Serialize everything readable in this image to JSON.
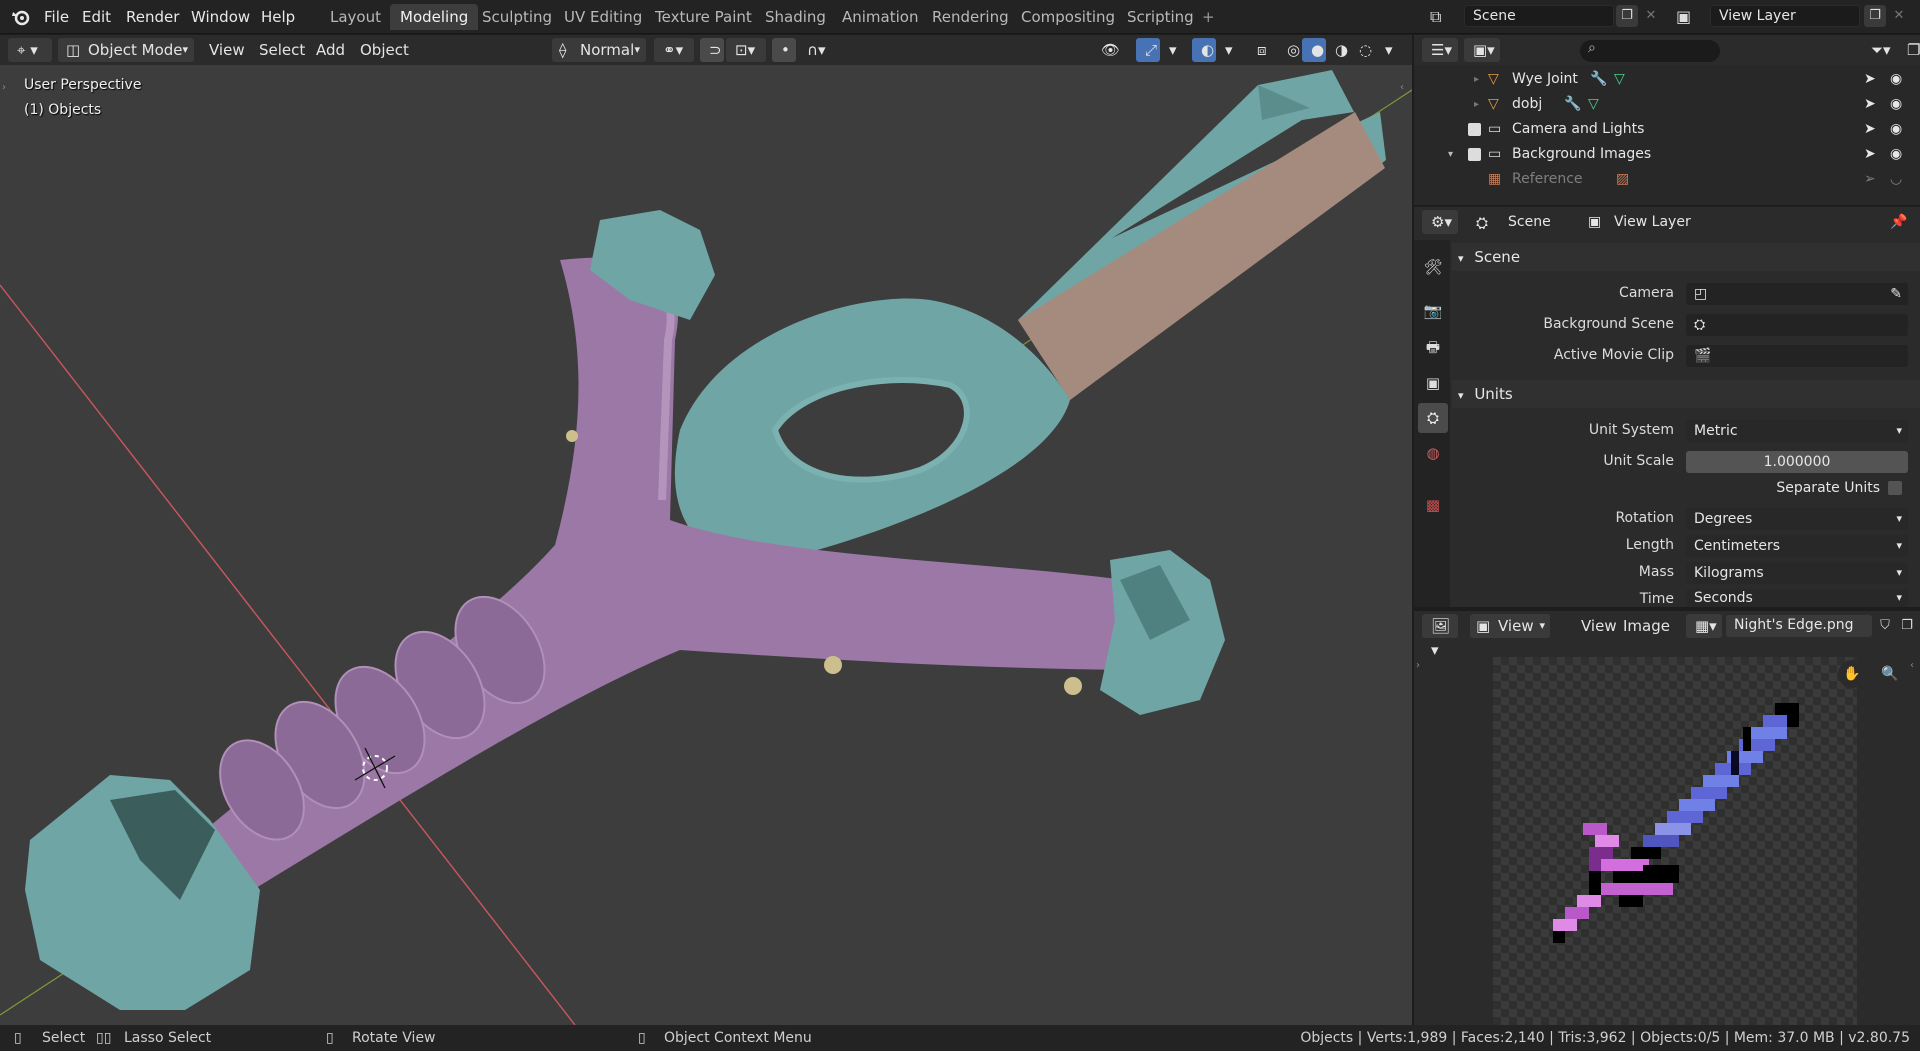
{
  "app": {
    "logo": "blender-logo-icon"
  },
  "menu": [
    "File",
    "Edit",
    "Render",
    "Window",
    "Help"
  ],
  "workspaces": [
    "Layout",
    "Modeling",
    "Sculpting",
    "UV Editing",
    "Texture Paint",
    "Shading",
    "Animation",
    "Rendering",
    "Compositing",
    "Scripting",
    "+"
  ],
  "active_workspace": "Modeling",
  "scene_selector": {
    "label": "Scene"
  },
  "view_layer_selector": {
    "label": "View Layer"
  },
  "viewport_header": {
    "mode": "Object Mode",
    "menus": [
      "View",
      "Select",
      "Add",
      "Object"
    ],
    "orientation": "Normal"
  },
  "viewport_overlay": {
    "line1": "User Perspective",
    "line2": "(1) Objects"
  },
  "outliner": {
    "rows": [
      {
        "name": "Wye Joint",
        "type": "mesh",
        "disabled": false
      },
      {
        "name": "dobj",
        "type": "mesh",
        "disabled": false
      },
      {
        "name": "Camera and Lights",
        "type": "collection",
        "disabled": false
      },
      {
        "name": "Background Images",
        "type": "collection",
        "disabled": false
      },
      {
        "name": "Reference",
        "type": "image",
        "disabled": true
      }
    ]
  },
  "properties": {
    "breadcrumb_scene": "Scene",
    "breadcrumb_view_layer": "View Layer",
    "scene_panel": {
      "title": "Scene",
      "camera_label": "Camera",
      "background_scene_label": "Background Scene",
      "active_movie_clip_label": "Active Movie Clip"
    },
    "units_panel": {
      "title": "Units",
      "unit_system_label": "Unit System",
      "unit_system": "Metric",
      "unit_scale_label": "Unit Scale",
      "unit_scale": "1.000000",
      "separate_units_label": "Separate Units",
      "rotation_label": "Rotation",
      "rotation": "Degrees",
      "length_label": "Length",
      "length": "Centimeters",
      "mass_label": "Mass",
      "mass": "Kilograms",
      "time_label": "Time",
      "time": "Seconds"
    }
  },
  "image_editor": {
    "view_mode": "View",
    "menus": [
      "View",
      "Image"
    ],
    "image_name": "Night's Edge.png"
  },
  "statusbar": {
    "left": [
      {
        "icon": "mouse-left-icon",
        "label": "Select"
      },
      {
        "icon": "mouse-drag-icon",
        "label": "Lasso Select"
      },
      {
        "icon": "mouse-middle-icon",
        "label": "Rotate View"
      },
      {
        "icon": "mouse-right-icon",
        "label": "Object Context Menu"
      }
    ],
    "stats": "Objects | Verts:1,989 | Faces:2,140 | Tris:3,962 | Objects:0/5 | Mem: 37.0 MB | v2.80.75"
  },
  "colors": {
    "pipe": "#9b78a6",
    "teal": "#6fa6a5",
    "blade_face": "#a58a7e",
    "axis_x": "#c9575e",
    "axis_y": "#7c9a3a",
    "accent": "#4772b3"
  }
}
